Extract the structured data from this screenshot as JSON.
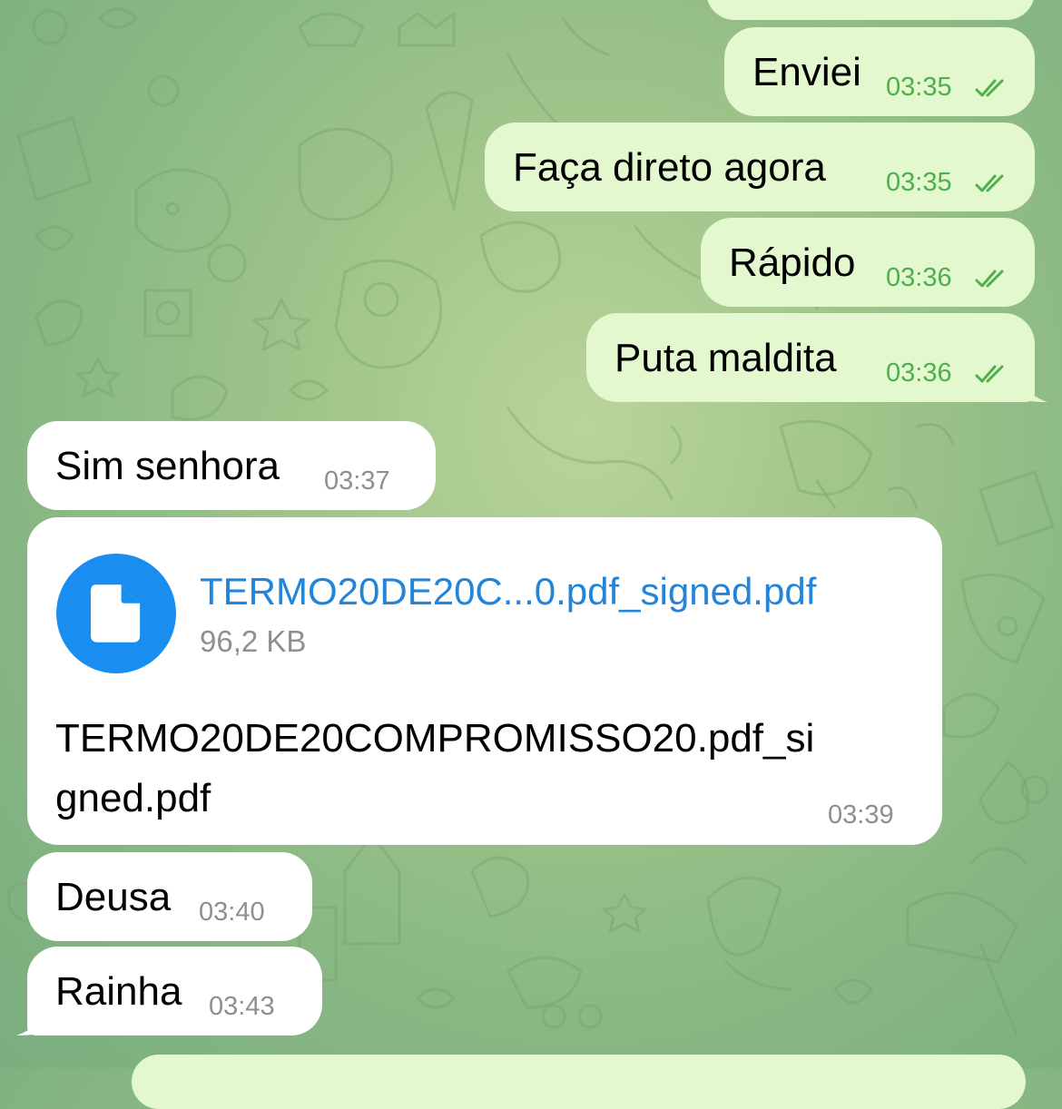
{
  "messages": [
    {
      "kind": "outgoing",
      "text": "Enviei",
      "time": "03:35",
      "status": "read"
    },
    {
      "kind": "outgoing",
      "text": "Faça direto agora",
      "time": "03:35",
      "status": "read"
    },
    {
      "kind": "outgoing",
      "text": "Rápido",
      "time": "03:36",
      "status": "read"
    },
    {
      "kind": "outgoing",
      "text": "Puta maldita",
      "time": "03:36",
      "status": "read"
    },
    {
      "kind": "incoming",
      "text": "Sim senhora",
      "time": "03:37"
    },
    {
      "kind": "incoming-file",
      "file_name": "TERMO20DE20C...0.pdf_signed.pdf",
      "file_size": "96,2 KB",
      "caption_lines": [
        "TERMO20DE20COMPROMISSO20.pdf_si",
        "gned.pdf"
      ],
      "time": "03:39",
      "icon": "document-icon"
    },
    {
      "kind": "incoming",
      "text": "Deusa",
      "time": "03:40"
    },
    {
      "kind": "incoming",
      "text": "Rainha",
      "time": "03:43"
    }
  ],
  "colors": {
    "outgoing_bubble": "#e4f8cf",
    "incoming_bubble": "#ffffff",
    "outgoing_meta": "#4fae4e",
    "incoming_meta": "#8e8e93",
    "file_link": "#2285d9",
    "file_icon_bg": "#1a8ef0",
    "background": "#9fc48a"
  }
}
